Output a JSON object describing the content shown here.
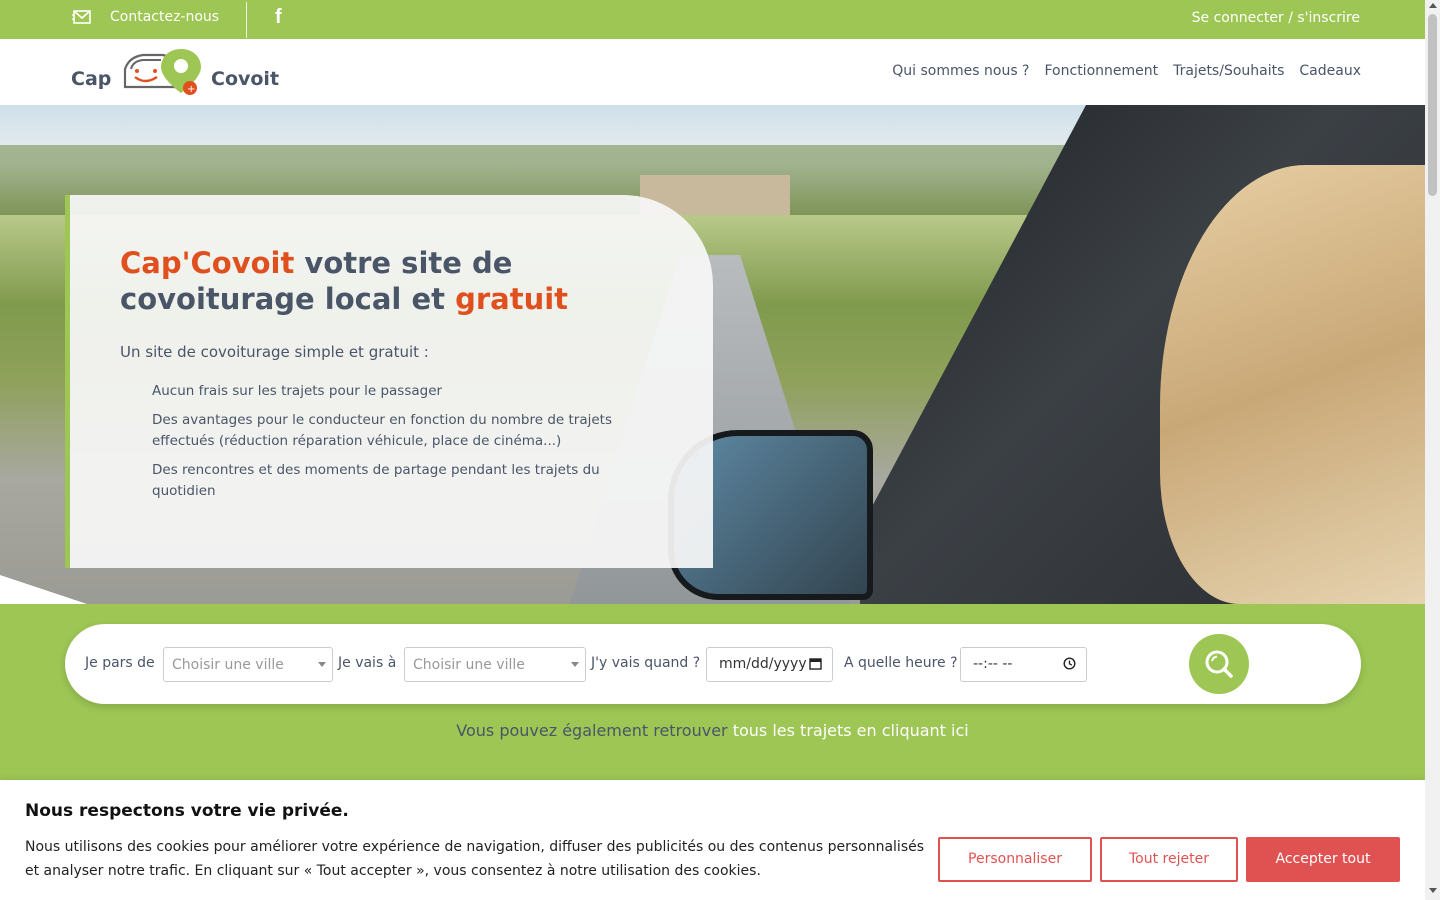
{
  "topbar": {
    "contact_label": "Contactez-nous",
    "facebook_glyph": "f",
    "login_label": "Se connecter / s'inscrire"
  },
  "header": {
    "logo_word_1": "Cap",
    "logo_word_2": "Covoit",
    "nav": [
      "Qui sommes nous ?",
      "Fonctionnement",
      "Trajets/Souhaits",
      "Cadeaux"
    ]
  },
  "hero": {
    "title_brand": "Cap'Covoit",
    "title_mid": " votre site de covoiturage local et ",
    "title_end": "gratuit",
    "lead": "Un site de covoiturage simple et gratuit :",
    "bullets": [
      "Aucun frais sur les trajets pour le passager",
      "Des avantages pour le conducteur en fonction du nombre de trajets effectués (réduction réparation véhicule, place de cinéma...)",
      "Des rencontres et des moments de partage pendant les trajets du quotidien"
    ]
  },
  "search": {
    "from_label": "Je pars de",
    "from_placeholder": "Choisir une ville",
    "to_label": "Je vais à",
    "to_placeholder": "Choisir une ville",
    "date_label": "J'y vais quand ?",
    "date_placeholder": "mm/dd/yyyy",
    "time_label": "A quelle heure ?",
    "time_placeholder": "--:-- --",
    "all_trips_prefix": "Vous pouvez également retrouver ",
    "all_trips_link": "tous les trajets en cliquant ici"
  },
  "cookie": {
    "title": "Nous respectons votre vie privée.",
    "text": "Nous utilisons des cookies pour améliorer votre expérience de navigation, diffuser des publicités ou des contenus personnalisés et analyser notre trafic. En cliquant sur « Tout accepter », vous consentez à notre utilisation des cookies.",
    "customize": "Personnaliser",
    "reject": "Tout rejeter",
    "accept": "Accepter tout"
  },
  "colors": {
    "brand_green": "#9dc654",
    "accent_red": "#e0501f",
    "cookie_red": "#e05252",
    "text": "#4a5568"
  },
  "icons": [
    "envelope-icon",
    "facebook-icon",
    "map-pin-icon",
    "search-icon",
    "calendar-icon",
    "clock-icon"
  ]
}
